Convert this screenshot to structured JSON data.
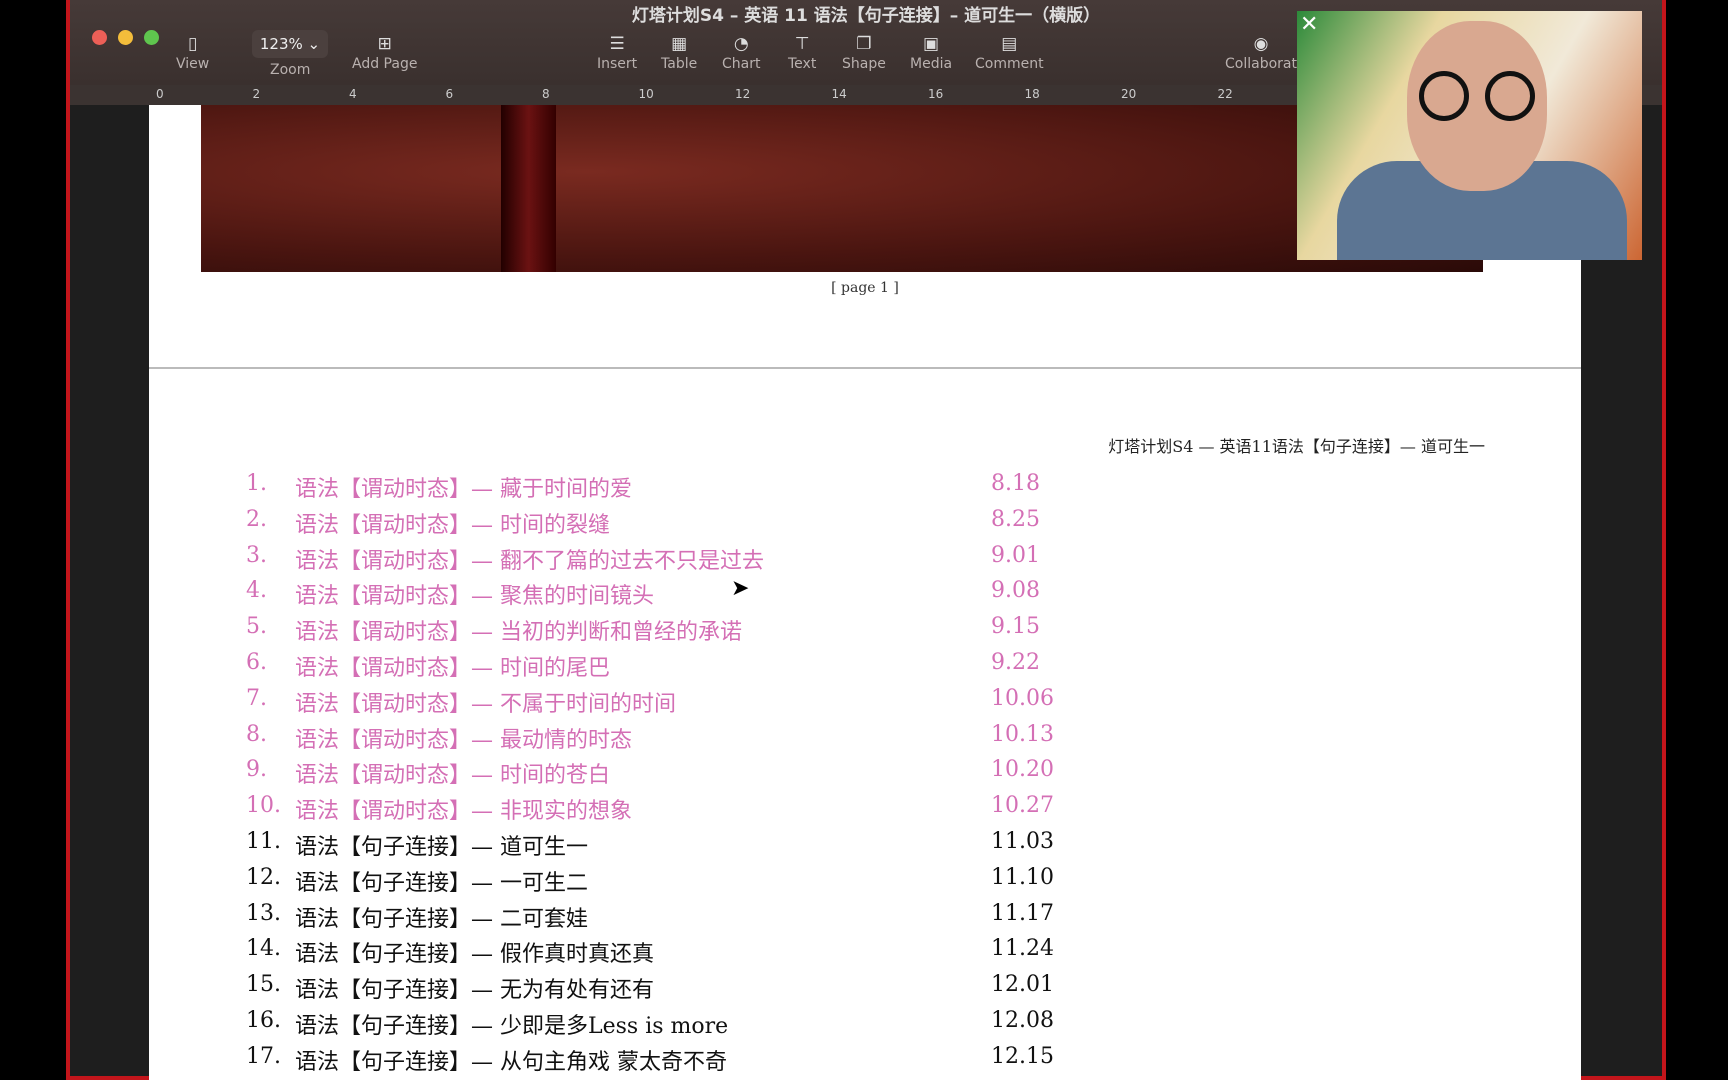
{
  "window": {
    "title": "灯塔计划S4 – 英语 11 语法【句子连接】– 道可生一（横版）"
  },
  "toolbar": {
    "view": "View",
    "zoom_value": "123%",
    "zoom": "Zoom",
    "add_page": "Add Page",
    "insert": "Insert",
    "table": "Table",
    "chart": "Chart",
    "text": "Text",
    "shape": "Shape",
    "media": "Media",
    "comment": "Comment",
    "collaborate": "Collaborat"
  },
  "ruler": [
    "0",
    "2",
    "4",
    "6",
    "8",
    "10",
    "12",
    "14",
    "16",
    "18",
    "20",
    "22"
  ],
  "page": {
    "label": "[ page 1 ]",
    "header": "灯塔计划S4 — 英语11语法【句子连接】— 道可生一"
  },
  "colors": {
    "done": "#d46fb5",
    "current": "#111111"
  },
  "items": [
    {
      "n": "1.",
      "t": "语法【谓动时态】— 藏于时间的爱",
      "d": "8.18",
      "done": true
    },
    {
      "n": "2.",
      "t": "语法【谓动时态】— 时间的裂缝",
      "d": "8.25",
      "done": true
    },
    {
      "n": "3.",
      "t": "语法【谓动时态】— 翻不了篇的过去不只是过去",
      "d": "9.01",
      "done": true
    },
    {
      "n": "4.",
      "t": "语法【谓动时态】— 聚焦的时间镜头",
      "d": "9.08",
      "done": true
    },
    {
      "n": "5.",
      "t": "语法【谓动时态】— 当初的判断和曾经的承诺",
      "d": "9.15",
      "done": true
    },
    {
      "n": "6.",
      "t": "语法【谓动时态】— 时间的尾巴",
      "d": "9.22",
      "done": true
    },
    {
      "n": "7.",
      "t": "语法【谓动时态】— 不属于时间的时间",
      "d": "10.06",
      "done": true
    },
    {
      "n": "8.",
      "t": "语法【谓动时态】— 最动情的时态",
      "d": "10.13",
      "done": true
    },
    {
      "n": "9.",
      "t": "语法【谓动时态】— 时间的苍白",
      "d": "10.20",
      "done": true
    },
    {
      "n": "10.",
      "t": "语法【谓动时态】— 非现实的想象",
      "d": "10.27",
      "done": true
    },
    {
      "n": "11.",
      "t": "语法【句子连接】— 道可生一",
      "d": "11.03",
      "done": false
    },
    {
      "n": "12.",
      "t": "语法【句子连接】— 一可生二",
      "d": "11.10",
      "done": false
    },
    {
      "n": "13.",
      "t": "语法【句子连接】— 二可套娃",
      "d": "11.17",
      "done": false
    },
    {
      "n": "14.",
      "t": "语法【句子连接】— 假作真时真还真",
      "d": "11.24",
      "done": false
    },
    {
      "n": "15.",
      "t": "语法【句子连接】— 无为有处有还有",
      "d": "12.01",
      "done": false
    },
    {
      "n": "16.",
      "t": "语法【句子连接】— 少即是多Less is more",
      "d": "12.08",
      "done": false
    },
    {
      "n": "17.",
      "t": "语法【句子连接】— 从句主角戏 蒙太奇不奇",
      "d": "12.15",
      "done": false
    }
  ]
}
